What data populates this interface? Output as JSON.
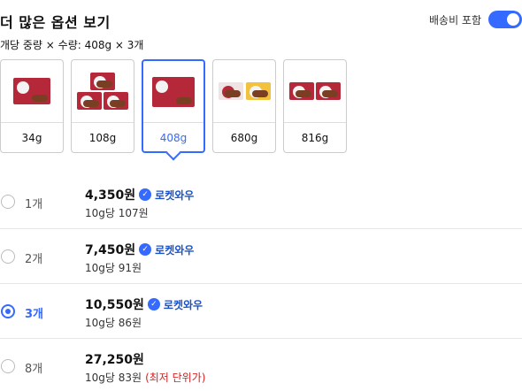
{
  "header": {
    "title": "더 많은 옵션 보기",
    "shipping_toggle_label": "배송비 포함",
    "shipping_toggle_on": true
  },
  "sub_info": "개당 중량 × 수량: 408g × 3개",
  "options": [
    {
      "label": "34g",
      "selected": false
    },
    {
      "label": "108g",
      "selected": false
    },
    {
      "label": "408g",
      "selected": true
    },
    {
      "label": "680g",
      "selected": false
    },
    {
      "label": "816g",
      "selected": false
    }
  ],
  "quantities": [
    {
      "qty": "1개",
      "price": "4,350원",
      "badge": "로켓와우",
      "unit_price": "10g당 107원",
      "note": "",
      "selected": false
    },
    {
      "qty": "2개",
      "price": "7,450원",
      "badge": "로켓와우",
      "unit_price": "10g당 91원",
      "note": "",
      "selected": false
    },
    {
      "qty": "3개",
      "price": "10,550원",
      "badge": "로켓와우",
      "unit_price": "10g당 86원",
      "note": "",
      "selected": true
    },
    {
      "qty": "8개",
      "price": "27,250원",
      "badge": "",
      "unit_price": "10g당 83원",
      "note": "(최저 단위가)",
      "selected": false
    }
  ],
  "colors": {
    "accent": "#346aff",
    "rocket_badge": "#1a53c7",
    "lowest_price": "#d92020"
  },
  "icons": [
    "rocket-wow-icon",
    "toggle-switch",
    "radio-button"
  ]
}
